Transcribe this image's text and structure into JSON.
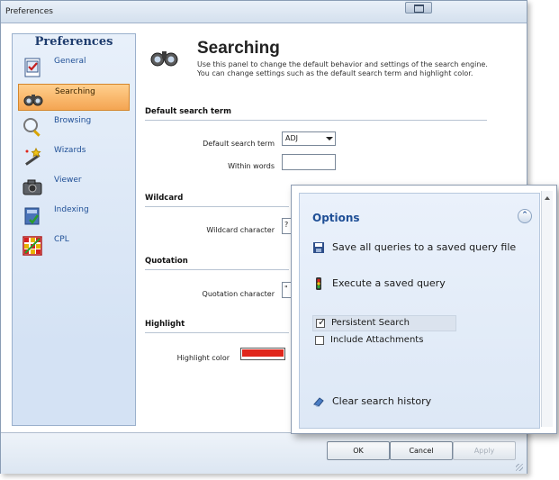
{
  "window": {
    "title": "Preferences"
  },
  "nav": {
    "header": "Preferences",
    "items": [
      {
        "label": "General",
        "icon": "checklist-icon",
        "selected": false
      },
      {
        "label": "Searching",
        "icon": "binoculars-icon",
        "selected": true
      },
      {
        "label": "Browsing",
        "icon": "magnifier-icon",
        "selected": false
      },
      {
        "label": "Wizards",
        "icon": "wand-icon",
        "selected": false
      },
      {
        "label": "Viewer",
        "icon": "camera-icon",
        "selected": false
      },
      {
        "label": "Indexing",
        "icon": "index-book-icon",
        "selected": false
      },
      {
        "label": "CPL",
        "icon": "grid-icon",
        "selected": false
      }
    ]
  },
  "page": {
    "title": "Searching",
    "description": "Use this panel to change the default behavior and settings of the search engine. You can change settings such as the default search term and highlight color.",
    "sections": {
      "default_term": {
        "heading": "Default search term",
        "term_label": "Default search term",
        "term_value": "ADJ",
        "within_label": "Within words",
        "within_value": ""
      },
      "wildcard": {
        "heading": "Wildcard",
        "char_label": "Wildcard character",
        "char_value": "?"
      },
      "quotation": {
        "heading": "Quotation",
        "char_label": "Quotation character",
        "char_value": "\""
      },
      "highlight": {
        "heading": "Highlight",
        "color_label": "Highlight color",
        "color_value": "#e0261b"
      }
    }
  },
  "footer": {
    "ok": "OK",
    "cancel": "Cancel",
    "apply": "Apply"
  },
  "options_popup": {
    "title": "Options",
    "save_queries": "Save all queries to a saved query file",
    "execute_query": "Execute a saved query",
    "persistent_search": {
      "label": "Persistent Search",
      "checked": true
    },
    "include_attachments": {
      "label": "Include Attachments",
      "checked": false
    },
    "clear_history": "Clear search history"
  },
  "colors": {
    "accent": "#1f4f96",
    "selected_nav": "#f4a552",
    "highlight": "#e0261b"
  }
}
